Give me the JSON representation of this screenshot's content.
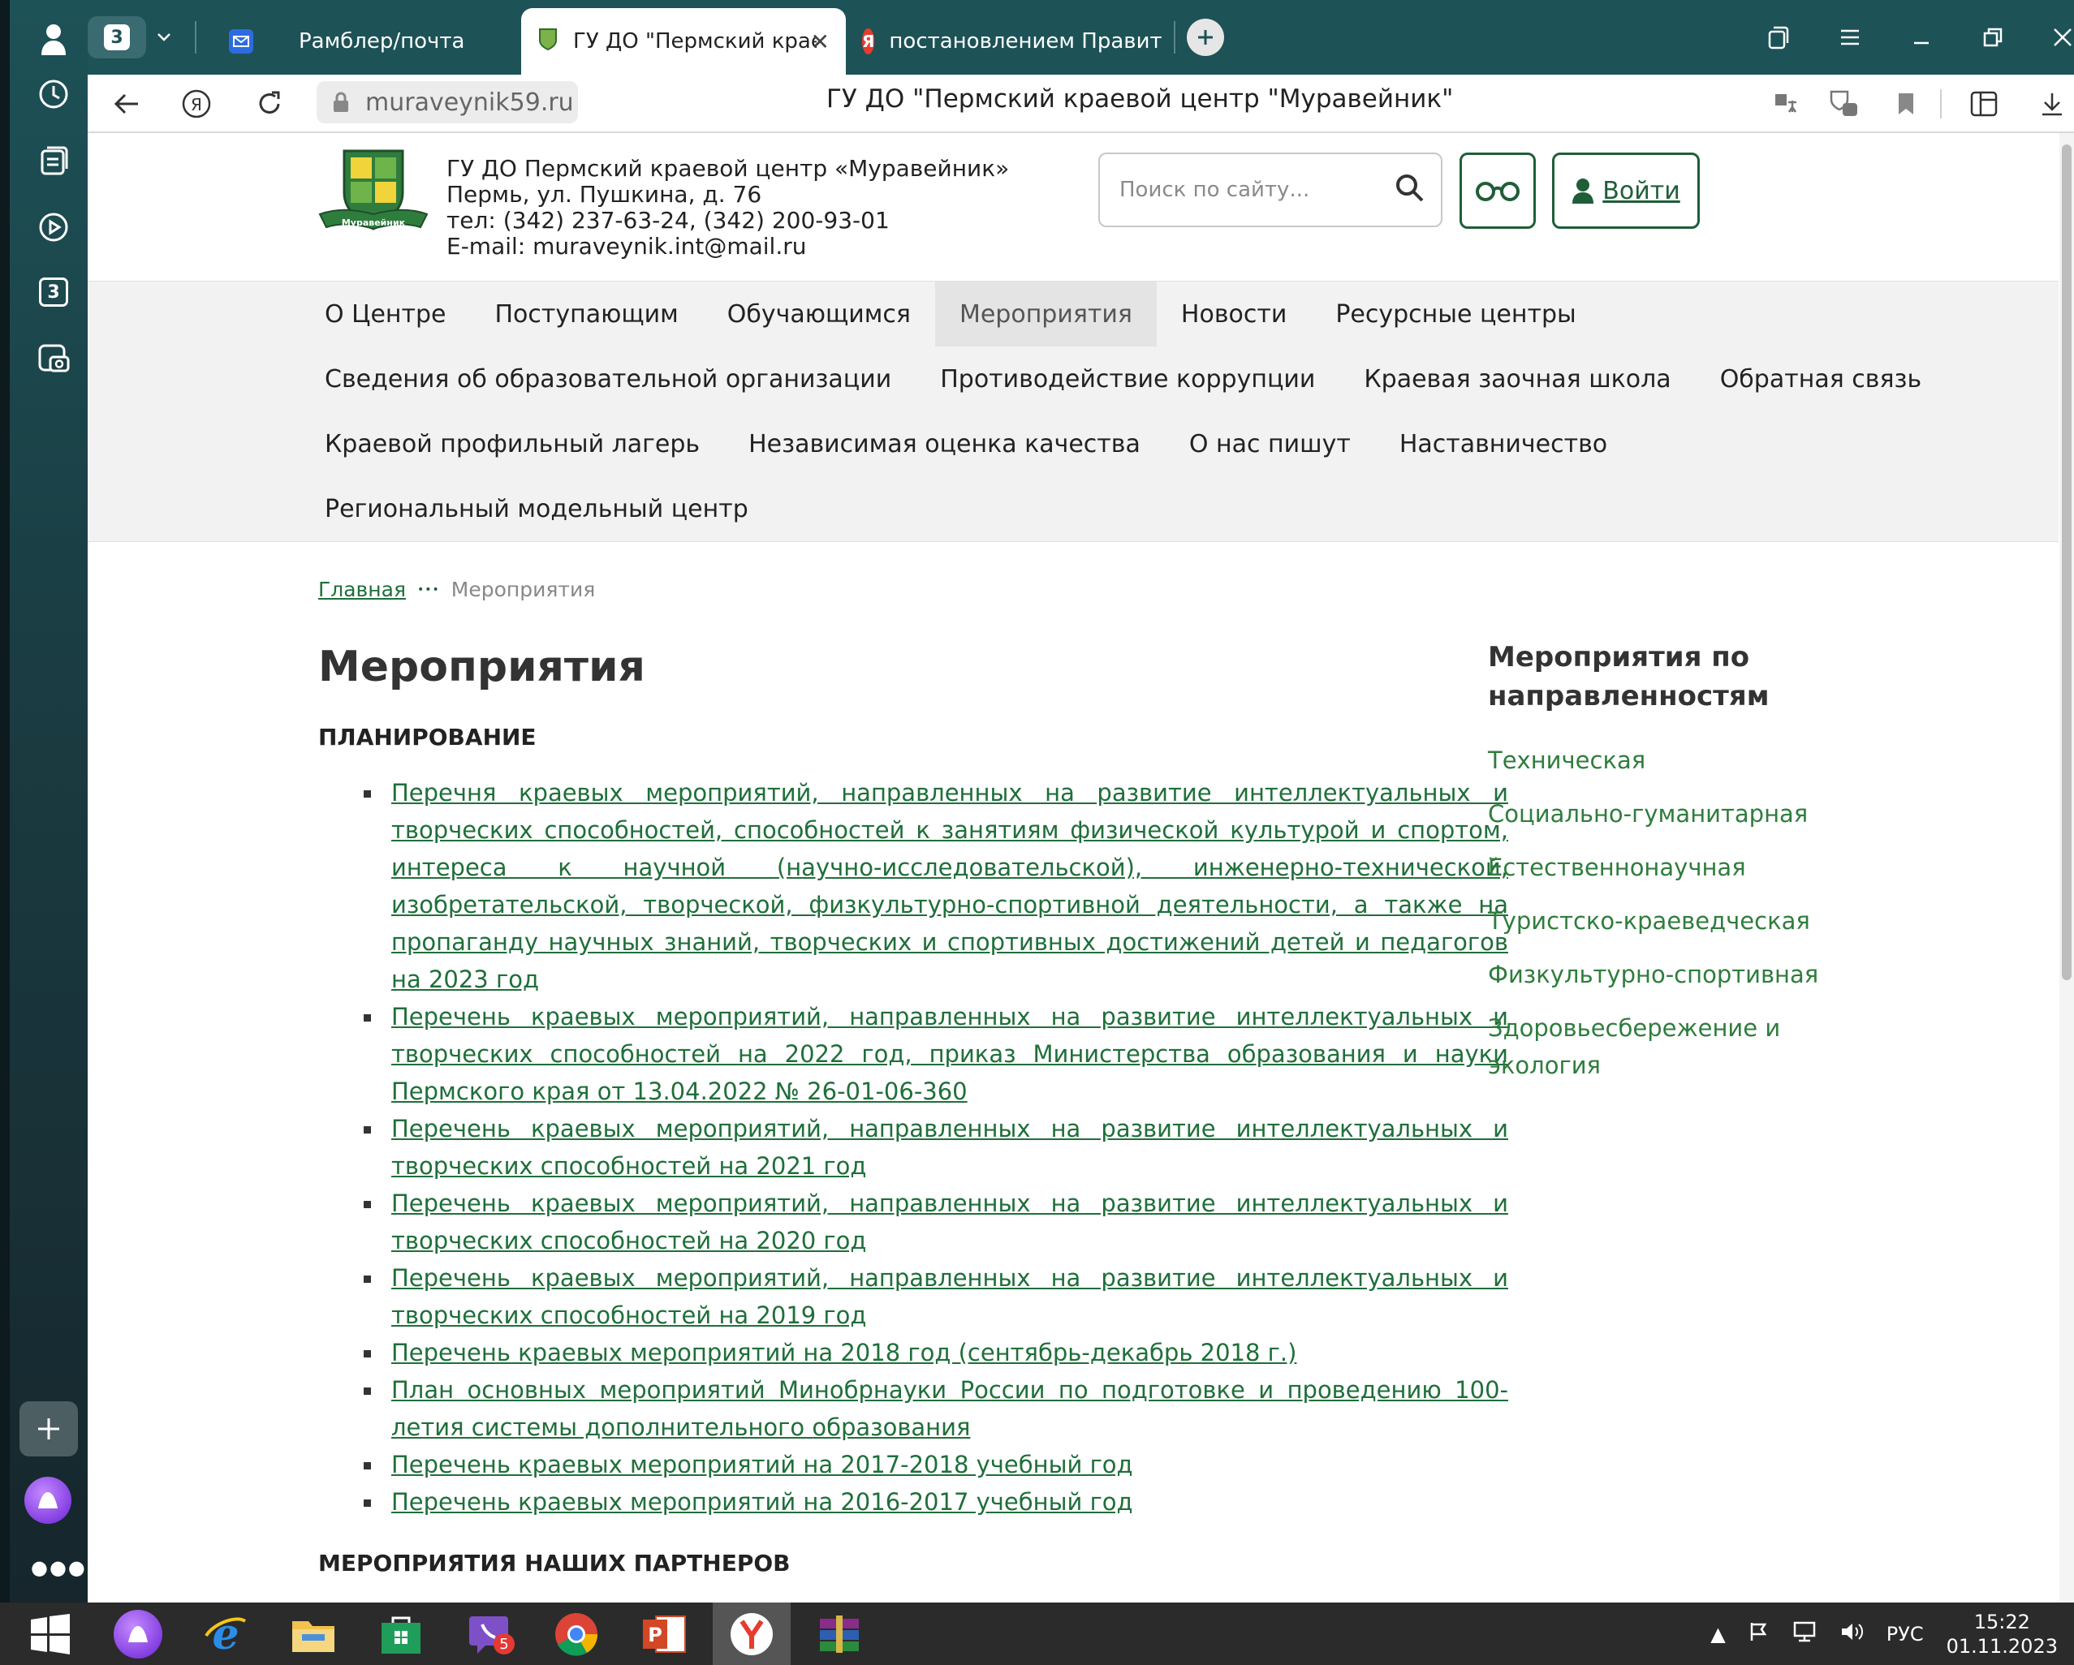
{
  "browser": {
    "tab_count_badge": "3",
    "tabs": [
      {
        "label": "Рамблер/почта"
      },
      {
        "label": "ГУ ДО \"Пермский крае"
      },
      {
        "label": "постановлением Правите"
      }
    ],
    "url": "muraveynik59.ru",
    "page_title": "ГУ ДО \"Пермский краевой центр \"Муравейник\"",
    "sidebar_badge": "3"
  },
  "site": {
    "org_name": "ГУ ДО Пермский краевой центр «Муравейник»",
    "address": "Пермь, ул. Пушкина, д. 76",
    "phone": "тел: (342) 237-63-24, (342) 200-93-01",
    "email": "E-mail: muraveynik.int@mail.ru",
    "logo_ribbon": "Муравейник",
    "search_placeholder": "Поиск по сайту...",
    "login_label": "Войти"
  },
  "menu": {
    "row1": [
      "О Центре",
      "Поступающим",
      "Обучающимся",
      "Мероприятия",
      "Новости",
      "Ресурсные центры"
    ],
    "row2": [
      "Сведения об образовательной организации",
      "Противодействие коррупции",
      "Краевая заочная школа",
      "Обратная связь"
    ],
    "row3": [
      "Краевой профильный лагерь",
      "Независимая оценка качества",
      "О нас пишут",
      "Наставничество"
    ],
    "row4": [
      "Региональный модельный центр"
    ]
  },
  "breadcrumb": {
    "home": "Главная",
    "sep": "•••",
    "current": "Мероприятия"
  },
  "content": {
    "title": "Мероприятия",
    "section_planning": "ПЛАНИРОВАНИЕ",
    "events": [
      "Перечня краевых мероприятий, направленных на развитие интеллектуальных и творческих способностей, способностей к занятиям физической культурой и спортом, интереса к научной (научно-исследовательской), инженерно-технической, изобретательской, творческой, физкультурно-спортивной деятельности, а также на пропаганду научных знаний, творческих и спортивных достижений детей и педагогов на 2023 год",
      "Перечень краевых мероприятий, направленных на развитие интеллектуальных и творческих способностей на 2022 год, приказ Министерства образования и науки Пермского края от 13.04.2022 № 26-01-06-360",
      "Перечень краевых мероприятий, направленных на развитие интеллектуальных и творческих способностей на 2021 год",
      "Перечень краевых мероприятий, направленных на развитие интеллектуальных и творческих способностей на 2020 год",
      "Перечень краевых мероприятий, направленных на развитие интеллектуальных и творческих способностей на 2019 год",
      "Перечень краевых мероприятий на 2018 год (сентябрь-декабрь 2018 г.)",
      "План основных мероприятий Минобрнауки России по подготовке и проведению 100-летия системы дополнительного образования",
      "Перечень краевых мероприятий на 2017-2018 учебный год",
      "Перечень краевых мероприятий на 2016-2017 учебный год"
    ],
    "section_partners": "МЕРОПРИЯТИЯ НАШИХ ПАРТНЕРОВ"
  },
  "aside": {
    "title": "Мероприятия по направленностям",
    "items": [
      "Техническая",
      "Социально-гуманитарная",
      "Естественнонаучная",
      "Туристско-краеведческая",
      "Физкультурно-спортивная",
      "Здоровьесбережение и экология"
    ]
  },
  "taskbar": {
    "viber_badge": "5",
    "lang": "РУС",
    "time": "15:22",
    "date": "01.11.2023"
  },
  "colors": {
    "accent": "#1f5e38",
    "link": "#1f6f3a",
    "browser": "#1d5257"
  }
}
